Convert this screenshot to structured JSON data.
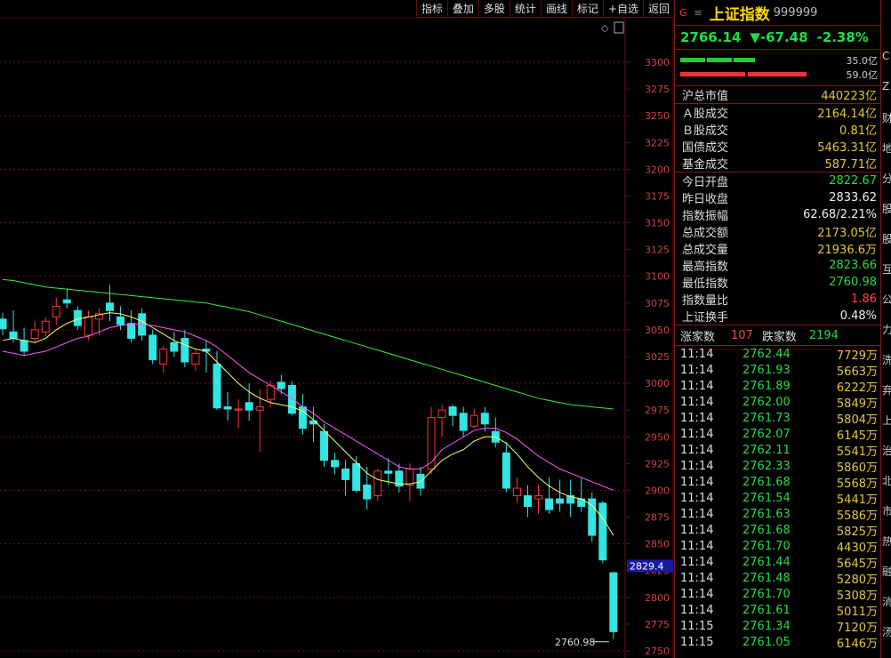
{
  "toolbar": [
    "指标",
    "叠加",
    "多股",
    "统计",
    "画线",
    "标记",
    "+自选",
    "返回"
  ],
  "chart_data": {
    "type": "candlestick",
    "y_ticks": [
      3300,
      3275,
      3250,
      3225,
      3200,
      3175,
      3150,
      3125,
      3100,
      3075,
      3050,
      3025,
      3000,
      2975,
      2950,
      2925,
      2900,
      2875,
      2850,
      2825,
      2800,
      2775,
      2750
    ],
    "ylim": [
      2750,
      3305
    ],
    "current_price_label": "2829.4",
    "low_annotation": "2760.98",
    "candles": [
      [
        3060,
        3066,
        3045,
        3051
      ],
      [
        3048,
        3068,
        3038,
        3042
      ],
      [
        3040,
        3052,
        3026,
        3030
      ],
      [
        3042,
        3058,
        3038,
        3050
      ],
      [
        3048,
        3062,
        3044,
        3058
      ],
      [
        3062,
        3080,
        3055,
        3072
      ],
      [
        3078,
        3088,
        3070,
        3075
      ],
      [
        3068,
        3072,
        3050,
        3054
      ],
      [
        3045,
        3068,
        3040,
        3062
      ],
      [
        3060,
        3070,
        3045,
        3065
      ],
      [
        3075,
        3092,
        3058,
        3068
      ],
      [
        3062,
        3072,
        3050,
        3055
      ],
      [
        3056,
        3068,
        3038,
        3042
      ],
      [
        3065,
        3070,
        3040,
        3045
      ],
      [
        3045,
        3050,
        3018,
        3022
      ],
      [
        3018,
        3035,
        3010,
        3032
      ],
      [
        3038,
        3048,
        3025,
        3030
      ],
      [
        3042,
        3050,
        3015,
        3020
      ],
      [
        3018,
        3032,
        3012,
        3028
      ],
      [
        3032,
        3040,
        3010,
        3030
      ],
      [
        3018,
        3030,
        2975,
        2977
      ],
      [
        2978,
        2992,
        2965,
        2976
      ],
      [
        2975,
        2985,
        2958,
        2976
      ],
      [
        2982,
        3000,
        2965,
        2975
      ],
      [
        2975,
        2995,
        2936,
        2978
      ],
      [
        2985,
        3002,
        2978,
        2998
      ],
      [
        3001,
        3008,
        2990,
        2995
      ],
      [
        2998,
        3002,
        2970,
        2972
      ],
      [
        2978,
        2990,
        2952,
        2958
      ],
      [
        2965,
        2978,
        2945,
        2962
      ],
      [
        2955,
        2962,
        2922,
        2928
      ],
      [
        2928,
        2935,
        2915,
        2922
      ],
      [
        2920,
        2928,
        2895,
        2910
      ],
      [
        2925,
        2932,
        2898,
        2900
      ],
      [
        2905,
        2922,
        2882,
        2892
      ],
      [
        2895,
        2920,
        2890,
        2918
      ],
      [
        2918,
        2930,
        2905,
        2916
      ],
      [
        2918,
        2925,
        2898,
        2904
      ],
      [
        2905,
        2925,
        2890,
        2920
      ],
      [
        2915,
        2922,
        2895,
        2902
      ],
      [
        2920,
        2978,
        2915,
        2968
      ],
      [
        2968,
        2980,
        2950,
        2975
      ],
      [
        2978,
        2980,
        2960,
        2970
      ],
      [
        2972,
        2978,
        2950,
        2956
      ],
      [
        2960,
        2976,
        2958,
        2970
      ],
      [
        2972,
        2978,
        2955,
        2962
      ],
      [
        2955,
        2968,
        2940,
        2945
      ],
      [
        2935,
        2945,
        2898,
        2902
      ],
      [
        2895,
        2912,
        2888,
        2902
      ],
      [
        2895,
        2905,
        2875,
        2885
      ],
      [
        2892,
        2905,
        2878,
        2895
      ],
      [
        2892,
        2912,
        2878,
        2882
      ],
      [
        2892,
        2910,
        2880,
        2888
      ],
      [
        2895,
        2910,
        2875,
        2888
      ],
      [
        2892,
        2912,
        2880,
        2885
      ],
      [
        2892,
        2898,
        2852,
        2858
      ],
      [
        2888,
        2890,
        2832,
        2835
      ],
      [
        2823,
        2824,
        2761,
        2768
      ]
    ],
    "ma_series": [
      {
        "color": "#ffff66",
        "values": [
          3040,
          3042,
          3040,
          3038,
          3042,
          3050,
          3056,
          3060,
          3062,
          3064,
          3066,
          3065,
          3062,
          3058,
          3052,
          3046,
          3040,
          3036,
          3032,
          3030,
          3020,
          3010,
          3000,
          2992,
          2986,
          2982,
          2980,
          2978,
          2974,
          2966,
          2956,
          2946,
          2936,
          2926,
          2916,
          2910,
          2908,
          2906,
          2906,
          2908,
          2918,
          2928,
          2934,
          2938,
          2946,
          2950,
          2950,
          2944,
          2934,
          2922,
          2912,
          2904,
          2898,
          2894,
          2892,
          2886,
          2874,
          2858
        ]
      },
      {
        "color": "#ff55ff",
        "values": [
          3030,
          3028,
          3026,
          3028,
          3030,
          3034,
          3038,
          3042,
          3044,
          3048,
          3052,
          3054,
          3055,
          3055,
          3054,
          3052,
          3050,
          3048,
          3044,
          3040,
          3034,
          3026,
          3018,
          3010,
          3004,
          2998,
          2992,
          2986,
          2978,
          2972,
          2964,
          2958,
          2952,
          2946,
          2940,
          2934,
          2928,
          2922,
          2920,
          2920,
          2926,
          2938,
          2944,
          2950,
          2956,
          2958,
          2958,
          2954,
          2948,
          2940,
          2932,
          2926,
          2920,
          2916,
          2912,
          2908,
          2904,
          2900
        ]
      },
      {
        "color": "#33ee33",
        "values": [
          3097,
          3096,
          3094,
          3092,
          3090,
          3089,
          3088,
          3087,
          3086,
          3085,
          3084,
          3083,
          3082,
          3081,
          3080,
          3079,
          3078,
          3077,
          3076,
          3075,
          3073,
          3071,
          3069,
          3067,
          3064,
          3061,
          3058,
          3055,
          3052,
          3049,
          3046,
          3043,
          3040,
          3037,
          3034,
          3031,
          3028,
          3025,
          3022,
          3019,
          3016,
          3013,
          3010,
          3007,
          3004,
          3001,
          2998,
          2995,
          2992,
          2989,
          2986,
          2984,
          2982,
          2980,
          2979,
          2978,
          2977,
          2976
        ]
      }
    ]
  },
  "panel": {
    "g_label": "G",
    "menu_icon": "≡",
    "index_name": "上证指数",
    "index_code": "999999",
    "price": "2766.14",
    "change": "▼-67.48",
    "pct": "-2.38%",
    "bar1_label": "35.0亿",
    "bar2_label": "59.0亿",
    "bar1_frac": 0.35,
    "bar2_frac": 0.59,
    "market_cap_label": "沪总市值",
    "market_cap_value": "440223亿",
    "volumes": [
      {
        "label": "Ａ股成交",
        "value": "2164.14亿"
      },
      {
        "label": "Ｂ股成交",
        "value": "0.81亿"
      },
      {
        "label": "国债成交",
        "value": "5463.31亿"
      },
      {
        "label": "基金成交",
        "value": "587.71亿"
      }
    ],
    "stats": [
      {
        "label": "今日开盘",
        "value": "2822.67",
        "cls": "v-grn"
      },
      {
        "label": "昨日收盘",
        "value": "2833.62",
        "cls": "v-wht"
      },
      {
        "label": "指数振幅",
        "value": "62.68/2.21%",
        "cls": "v-wht"
      },
      {
        "label": "总成交额",
        "value": "2173.05亿",
        "cls": "v-yel"
      },
      {
        "label": "总成交量",
        "value": "21936.6万",
        "cls": "v-yel"
      },
      {
        "label": "最高指数",
        "value": "2823.66",
        "cls": "v-grn"
      },
      {
        "label": "最低指数",
        "value": "2760.98",
        "cls": "v-grn"
      },
      {
        "label": "指数量比",
        "value": "1.86",
        "cls": "v-red"
      },
      {
        "label": "上证换手",
        "value": "0.48%",
        "cls": "v-wht"
      }
    ],
    "up_label": "涨家数",
    "up_value": "107",
    "down_label": "跌家数",
    "down_value": "2194",
    "ticks": [
      [
        "11:14",
        "2762.44",
        "7729万"
      ],
      [
        "11:14",
        "2761.93",
        "5663万"
      ],
      [
        "11:14",
        "2761.89",
        "6222万"
      ],
      [
        "11:14",
        "2762.00",
        "5849万"
      ],
      [
        "11:14",
        "2761.73",
        "5804万"
      ],
      [
        "11:14",
        "2762.07",
        "6145万"
      ],
      [
        "11:14",
        "2762.11",
        "5541万"
      ],
      [
        "11:14",
        "2762.33",
        "5860万"
      ],
      [
        "11:14",
        "2761.68",
        "5568万"
      ],
      [
        "11:14",
        "2761.54",
        "5441万"
      ],
      [
        "11:14",
        "2761.63",
        "5586万"
      ],
      [
        "11:14",
        "2761.68",
        "5825万"
      ],
      [
        "11:14",
        "2761.70",
        "4430万"
      ],
      [
        "11:14",
        "2761.44",
        "5645万"
      ],
      [
        "11:14",
        "2761.48",
        "5280万"
      ],
      [
        "11:14",
        "2761.70",
        "5308万"
      ],
      [
        "11:14",
        "2761.61",
        "5011万"
      ],
      [
        "11:15",
        "2761.34",
        "7120万"
      ],
      [
        "11:15",
        "2761.05",
        "6146万"
      ]
    ]
  },
  "edge_chars": [
    "C",
    "Z",
    "财",
    "地",
    "分",
    "股",
    "股",
    "互",
    "公",
    "力",
    "洗",
    "弃",
    "上",
    "治",
    "北",
    "市",
    "热",
    "融",
    "消",
    "汤"
  ],
  "colors": {
    "up": "#ff3333",
    "down": "#33e5e5",
    "grid": "#6b1010"
  }
}
